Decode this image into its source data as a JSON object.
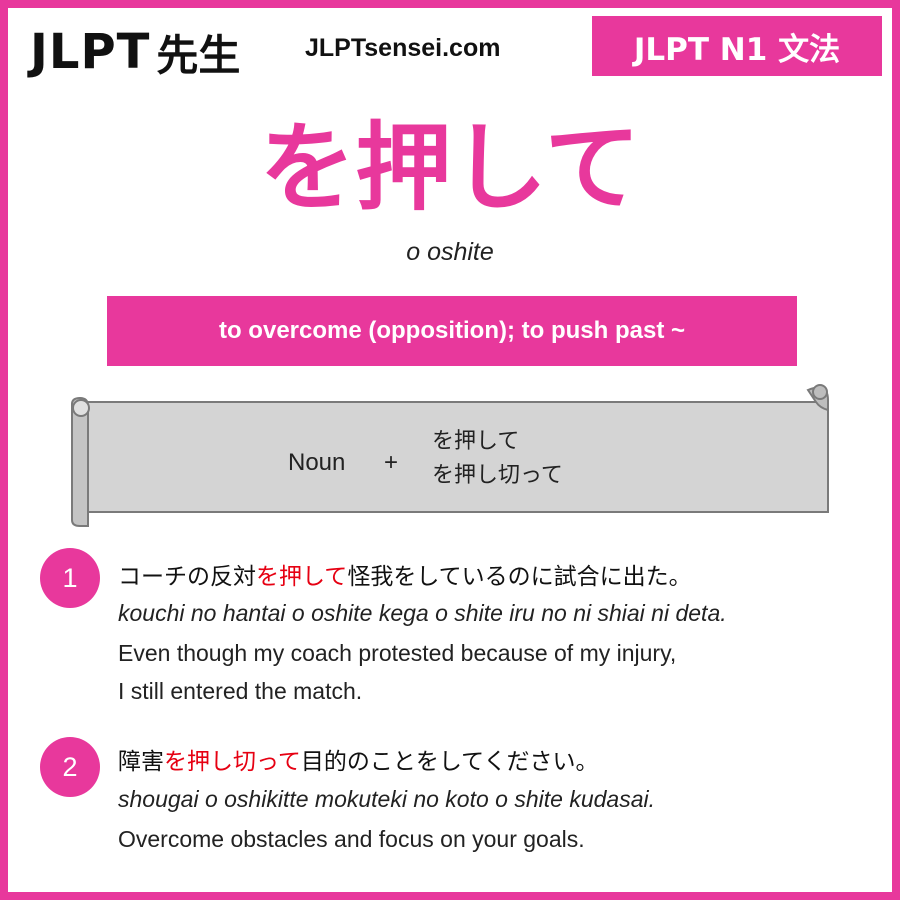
{
  "header": {
    "logo_jlpt": "JLPT",
    "logo_sensei": "先生",
    "site_url": "JLPTsensei.com",
    "level_badge": "JLPT N1 文法"
  },
  "grammar": {
    "title": "を押して",
    "romaji": "o oshite",
    "meaning": "to overcome (opposition); to push past ~"
  },
  "formula": {
    "noun": "Noun",
    "plus": "+",
    "forms": [
      "を押して",
      "を押し切って"
    ]
  },
  "examples": [
    {
      "number": "1",
      "jp_before": "コーチの反対",
      "jp_highlight": "を押して",
      "jp_after": "怪我をしているのに試合に出た。",
      "romaji": "kouchi no hantai o oshite kega o shite iru no ni shiai ni deta.",
      "english_line1": "Even though my coach protested because of my injury,",
      "english_line2": "I still entered the match."
    },
    {
      "number": "2",
      "jp_before": "障害",
      "jp_highlight": "を押し切って",
      "jp_after": "目的のことをしてください。",
      "romaji": "shougai o oshikitte mokuteki no koto o shite kudasai.",
      "english_line1": "Overcome obstacles and focus on your goals."
    }
  ],
  "colors": {
    "accent": "#e8389c",
    "highlight": "#e60012",
    "scroll_fill": "#d4d4d4"
  }
}
